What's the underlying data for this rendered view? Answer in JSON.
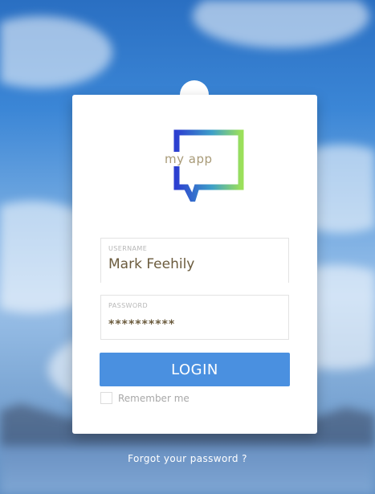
{
  "logo": {
    "text": "my app",
    "gradient_start": "#2c3fd0",
    "gradient_end": "#9be05a",
    "icon": "speech-bubble-icon"
  },
  "form": {
    "username": {
      "label": "USERNAME",
      "value": "Mark Feehily"
    },
    "password": {
      "label": "PASSWORD",
      "value": "**********"
    },
    "login_label": "LOGIN",
    "remember_label": "Remember me",
    "remember_checked": false
  },
  "forgot_label": "Forgot your password ?",
  "colors": {
    "accent": "#4a90e0",
    "card": "#ffffff",
    "input_text": "#6b5b3d"
  }
}
